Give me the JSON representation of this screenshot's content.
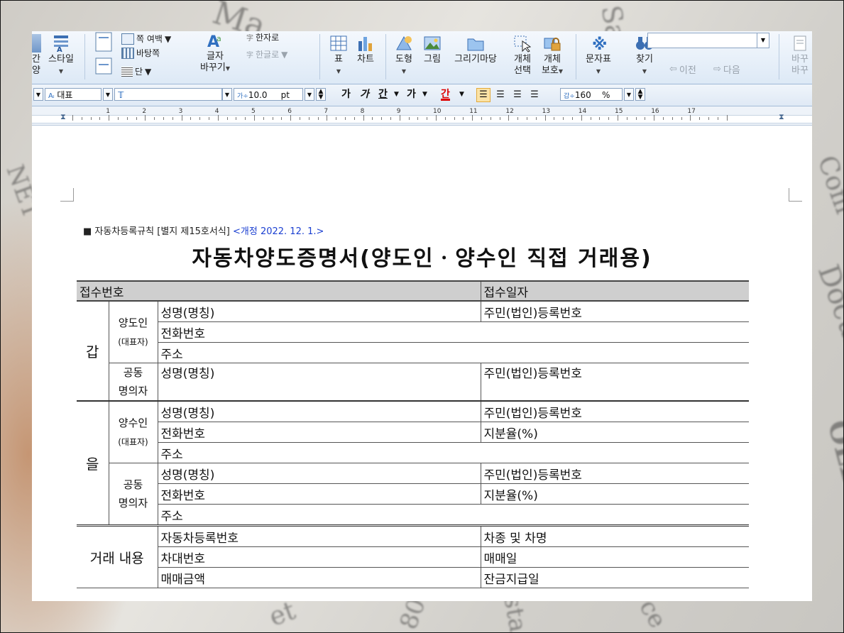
{
  "ribbon": {
    "style_label": "스타일",
    "cut_label_1": "간",
    "cut_label_2": "양",
    "page_margin_label": "쪽 여백",
    "background_label": "바탕쪽",
    "column_label": "단",
    "char_change_label_1": "글자",
    "char_change_label_2": "바꾸기",
    "hanja_label": "한자로",
    "hangul_label": "한글로",
    "table_label": "표",
    "chart_label": "차트",
    "shape_label": "도형",
    "picture_label": "그림",
    "drawing_label": "그리기마당",
    "object_select_label_1": "개체",
    "object_select_label_2": "선택",
    "object_protect_label_1": "개체",
    "object_protect_label_2": "보호",
    "char_table_label": "문자표",
    "find_label": "찾기",
    "prev_label": "이전",
    "next_label": "다음",
    "replace_label_1": "바꾸",
    "replace_label_2": "바꾸"
  },
  "toolbar": {
    "style_value": "대표",
    "font_value": "",
    "size_value": "10.0",
    "size_unit": "pt",
    "bold_label": "가",
    "italic_label": "가",
    "underline_label": "간",
    "strike_label": "가",
    "color_label": "간",
    "line_spacing_value": "160",
    "line_spacing_unit": "%"
  },
  "ruler": {
    "numbers": [
      "1",
      "2",
      "3",
      "4",
      "5",
      "6",
      "7",
      "8",
      "9",
      "10",
      "11",
      "12",
      "13",
      "14",
      "15",
      "16",
      "17"
    ]
  },
  "document": {
    "form_ref": "■ 자동차등록규칙 [별지 제15호서식]",
    "revision": "<개정 2022. 12. 1.>",
    "title": "자동차양도증명서(양도인ㆍ양수인 직접 거래용)",
    "receipt_no": "접수번호",
    "receipt_date": "접수일자",
    "gap": "갑",
    "eul": "을",
    "deal": "거래 내용",
    "seller": "양도인",
    "buyer": "양수인",
    "rep": "(대표자)",
    "co_owner_1": "공동",
    "co_owner_2": "명의자",
    "name": "성명(명칭)",
    "reg_no": "주민(법인)등록번호",
    "phone": "전화번호",
    "address": "주소",
    "share": "지분율(%)",
    "car_reg_no": "자동차등록번호",
    "car_type": "차종 및 차명",
    "vin": "차대번호",
    "sale_date": "매매일",
    "sale_amount": "매매금액",
    "balance_date": "잔금지급일"
  },
  "background": {
    "words": [
      "Ma",
      "Sa",
      "Com",
      "Docume",
      "NET",
      "OLDING",
      "et",
      "sta",
      "ce",
      "80"
    ]
  }
}
